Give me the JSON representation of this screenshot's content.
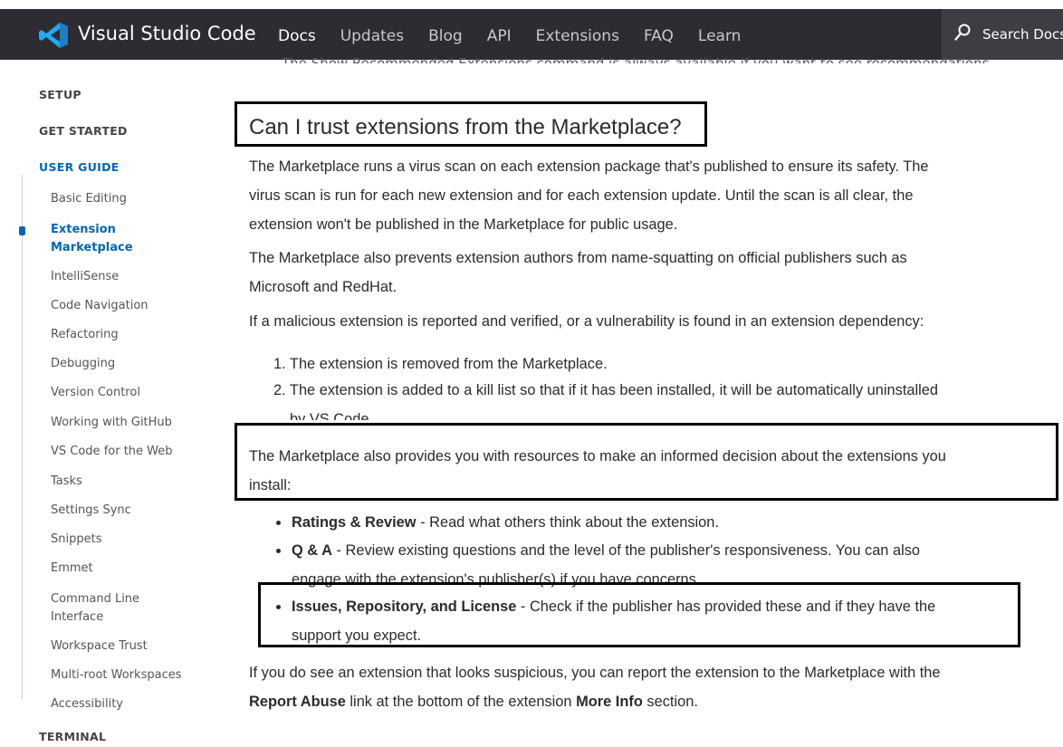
{
  "nav": {
    "brand": "Visual Studio Code",
    "links": [
      "Docs",
      "Updates",
      "Blog",
      "API",
      "Extensions",
      "FAQ",
      "Learn"
    ],
    "active": "Docs",
    "search_label": "Search Docs"
  },
  "cut_line": "The Show Recommended Extensions command is always available if you want to see recommendations.",
  "sidebar": {
    "categories": [
      "SETUP",
      "GET STARTED",
      "USER GUIDE",
      "TERMINAL"
    ],
    "items": [
      "Basic Editing",
      "Extension Marketplace",
      "IntelliSense",
      "Code Navigation",
      "Refactoring",
      "Debugging",
      "Version Control",
      "Working with GitHub",
      "VS Code for the Web",
      "Tasks",
      "Settings Sync",
      "Snippets",
      "Emmet",
      "Command Line Interface",
      "Workspace Trust",
      "Multi-root Workspaces",
      "Accessibility"
    ],
    "active_item": "Extension Marketplace",
    "extension_line1": "Extension",
    "extension_line2": "Marketplace",
    "cli_line1": "Command Line",
    "cli_line2": "Interface"
  },
  "article": {
    "heading": "Can I trust extensions from the Marketplace?",
    "p1_l1": "The Marketplace runs a virus scan on each extension package that's published to ensure its safety. The",
    "p1_l2": "virus scan is run for each new extension and for each extension update. Until the scan is all clear, the",
    "p1_l3": "extension won't be published in the Marketplace for public usage.",
    "p2_l1": "The Marketplace also prevents extension authors from name-squatting on official publishers such as",
    "p2_l2": "Microsoft and RedHat.",
    "p3": "If a malicious extension is reported and verified, or a vulnerability is found in an extension dependency:",
    "ol1": "1. The extension is removed from the Marketplace.",
    "ol2_l1": "2. The extension is added to a kill list so that if it has been installed, it will be automatically uninstalled",
    "ol2_l2": "by VS Code.",
    "p4_l1": "The Marketplace also provides you with resources to make an informed decision about the extensions you",
    "p4_l2": "install:",
    "b1_bold": "Ratings & Review",
    "b1_rest": " - Read what others think about the extension.",
    "b2_bold": "Q & A",
    "b2_rest": " - Review existing questions and the level of the publisher's responsiveness. You can also",
    "b2_l2": "engage with the extension's publisher(s) if you have concerns.",
    "b3_bold": "Issues, Repository, and License",
    "b3_rest": " - Check if the publisher has provided these and if they have the",
    "b3_l2": "support you expect.",
    "p5_l1": "If you do see an extension that looks suspicious, you can report the extension to the Marketplace with the",
    "p5_l2_b1": "Report Abuse",
    "p5_l2_mid": " link at the bottom of the extension ",
    "p5_l2_b2": "More Info",
    "p5_l2_end": " section."
  },
  "colors": {
    "nav_bg": "#2c2c32",
    "accent": "#0066b8",
    "logo": "#23a9f2"
  }
}
